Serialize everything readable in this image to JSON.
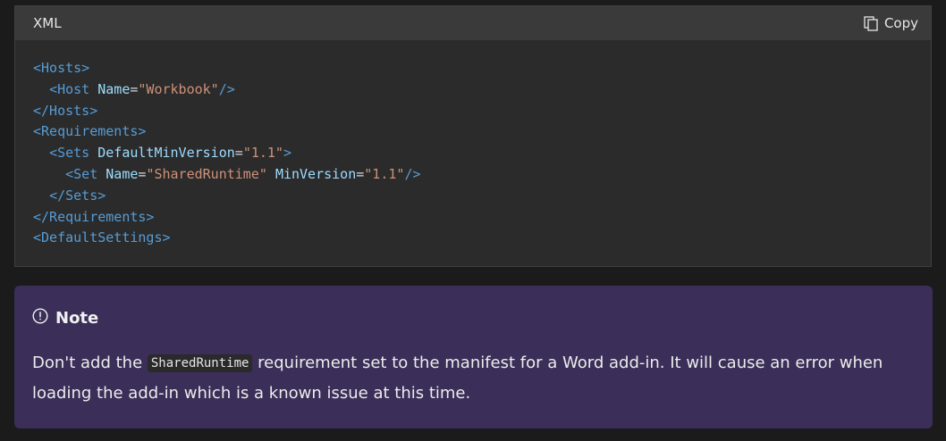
{
  "code_block": {
    "language": "XML",
    "copy_label": "Copy",
    "lines": [
      [
        {
          "t": "tag",
          "s": "<Hosts>"
        }
      ],
      [
        {
          "t": "plain",
          "s": "  "
        },
        {
          "t": "tag",
          "s": "<Host"
        },
        {
          "t": "plain",
          "s": " "
        },
        {
          "t": "attr",
          "s": "Name"
        },
        {
          "t": "eq",
          "s": "="
        },
        {
          "t": "val",
          "s": "\"Workbook\""
        },
        {
          "t": "tag",
          "s": "/>"
        }
      ],
      [
        {
          "t": "tag",
          "s": "</Hosts>"
        }
      ],
      [
        {
          "t": "tag",
          "s": "<Requirements>"
        }
      ],
      [
        {
          "t": "plain",
          "s": "  "
        },
        {
          "t": "tag",
          "s": "<Sets"
        },
        {
          "t": "plain",
          "s": " "
        },
        {
          "t": "attr",
          "s": "DefaultMinVersion"
        },
        {
          "t": "eq",
          "s": "="
        },
        {
          "t": "val",
          "s": "\"1.1\""
        },
        {
          "t": "tag",
          "s": ">"
        }
      ],
      [
        {
          "t": "plain",
          "s": "    "
        },
        {
          "t": "tag",
          "s": "<Set"
        },
        {
          "t": "plain",
          "s": " "
        },
        {
          "t": "attr",
          "s": "Name"
        },
        {
          "t": "eq",
          "s": "="
        },
        {
          "t": "val",
          "s": "\"SharedRuntime\""
        },
        {
          "t": "plain",
          "s": " "
        },
        {
          "t": "attr",
          "s": "MinVersion"
        },
        {
          "t": "eq",
          "s": "="
        },
        {
          "t": "val",
          "s": "\"1.1\""
        },
        {
          "t": "tag",
          "s": "/>"
        }
      ],
      [
        {
          "t": "plain",
          "s": "  "
        },
        {
          "t": "tag",
          "s": "</Sets>"
        }
      ],
      [
        {
          "t": "tag",
          "s": "</Requirements>"
        }
      ],
      [
        {
          "t": "tag",
          "s": "<DefaultSettings>"
        }
      ]
    ]
  },
  "note": {
    "title": "Note",
    "text_before": "Don't add the ",
    "inline_code": "SharedRuntime",
    "text_after": " requirement set to the manifest for a Word add-in. It will cause an error when loading the add-in which is a known issue at this time."
  },
  "icons": {
    "copy": "copy-icon",
    "note": "info-circle-icon"
  },
  "colors": {
    "page_bg": "#1b1b1b",
    "code_bg": "#2b2b2b",
    "code_header_bg": "#3a3a3a",
    "note_bg": "#3b2e58",
    "tag": "#569cd6",
    "attr": "#9cdcfe",
    "value": "#ce9178"
  }
}
